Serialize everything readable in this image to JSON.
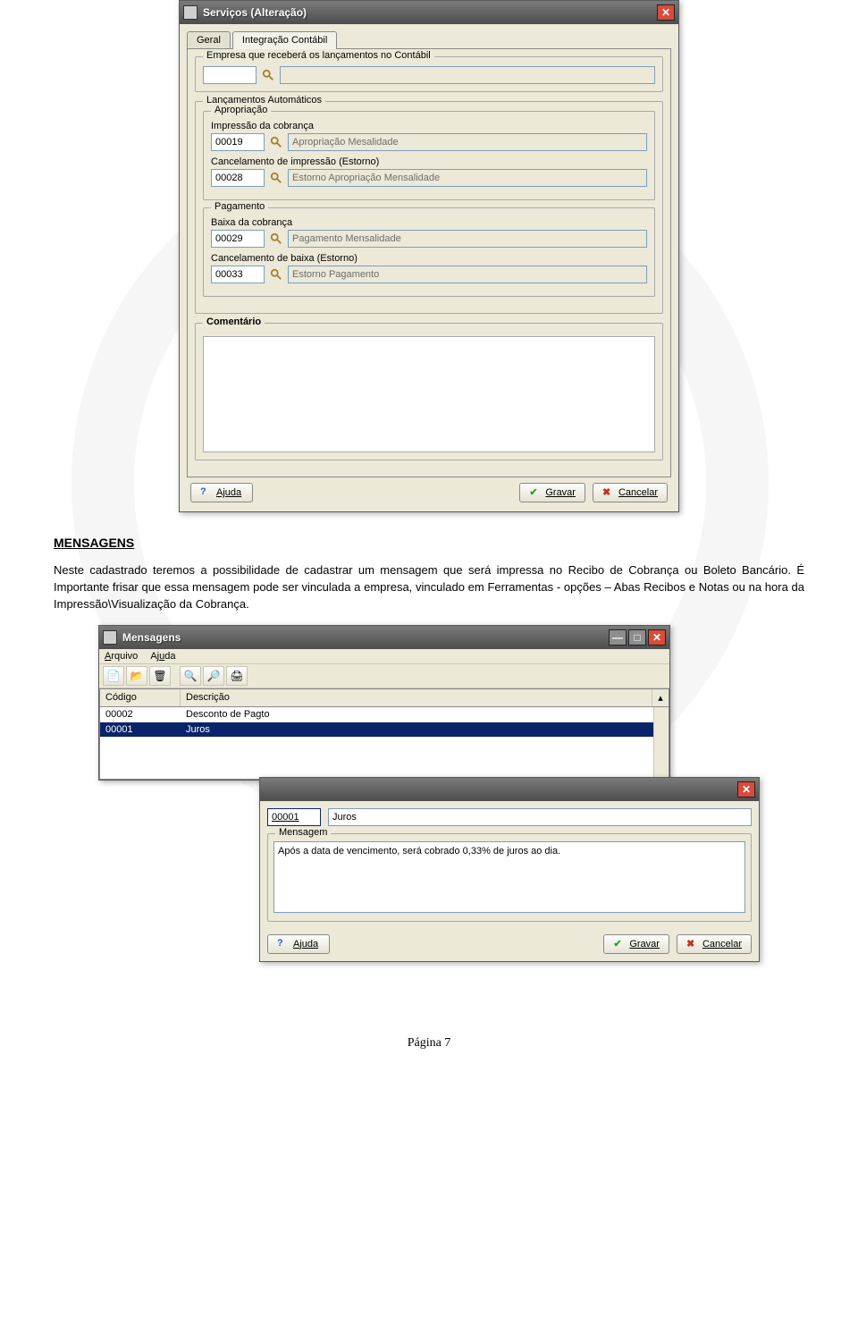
{
  "dialog1": {
    "title": "Serviços (Alteração)",
    "tabs": {
      "geral": "Geral",
      "integ": "Integração Contábil"
    },
    "empresa_group": "Empresa que receberá os lançamentos no Contábil",
    "lancamentos_group": "Lançamentos Automáticos",
    "apropria_group": "Apropriação",
    "pagamento_group": "Pagamento",
    "impressao_lbl": "Impressão da cobrança",
    "impressao_code": "00019",
    "impressao_desc": "Apropriação Mesalidade",
    "cancel_imp_lbl": "Cancelamento de impressão (Estorno)",
    "cancel_imp_code": "00028",
    "cancel_imp_desc": "Estorno Apropriação Mensalidade",
    "baixa_lbl": "Baixa da cobrança",
    "baixa_code": "00029",
    "baixa_desc": "Pagamento Mensalidade",
    "cancel_baixa_lbl": "Cancelamento de baixa (Estorno)",
    "cancel_baixa_code": "00033",
    "cancel_baixa_desc": "Estorno Pagamento",
    "comentario_label": "Comentário",
    "btn_ajuda": "Ajuda",
    "btn_gravar": "Gravar",
    "btn_cancelar": "Cancelar"
  },
  "section": {
    "heading": "MENSAGENS",
    "paragraph": "Neste cadastrado teremos a possibilidade de cadastrar um mensagem que será impressa no Recibo de Cobrança ou Boleto  Bancário. É Importante frisar que essa mensagem pode ser vinculada a empresa, vinculado em Ferramentas  - opções – Abas  Recibos e Notas ou na hora da Impressão\\Visualização da Cobrança."
  },
  "msgwin": {
    "title": "Mensagens",
    "menu_arquivo": "Arquivo",
    "menu_ajuda": "Ajuda",
    "hdr_codigo": "Código",
    "hdr_descricao": "Descrição",
    "rows": [
      {
        "code": "00002",
        "desc": "Desconto de Pagto"
      },
      {
        "code": "00001",
        "desc": "Juros"
      }
    ]
  },
  "dlg2": {
    "code": "00001",
    "desc": "Juros",
    "msg_label": "Mensagem",
    "msg_text": "Após a data de vencimento, será cobrado 0,33% de juros ao dia.",
    "btn_ajuda": "Ajuda",
    "btn_gravar": "Gravar",
    "btn_cancelar": "Cancelar"
  },
  "page_footer": "Página 7"
}
